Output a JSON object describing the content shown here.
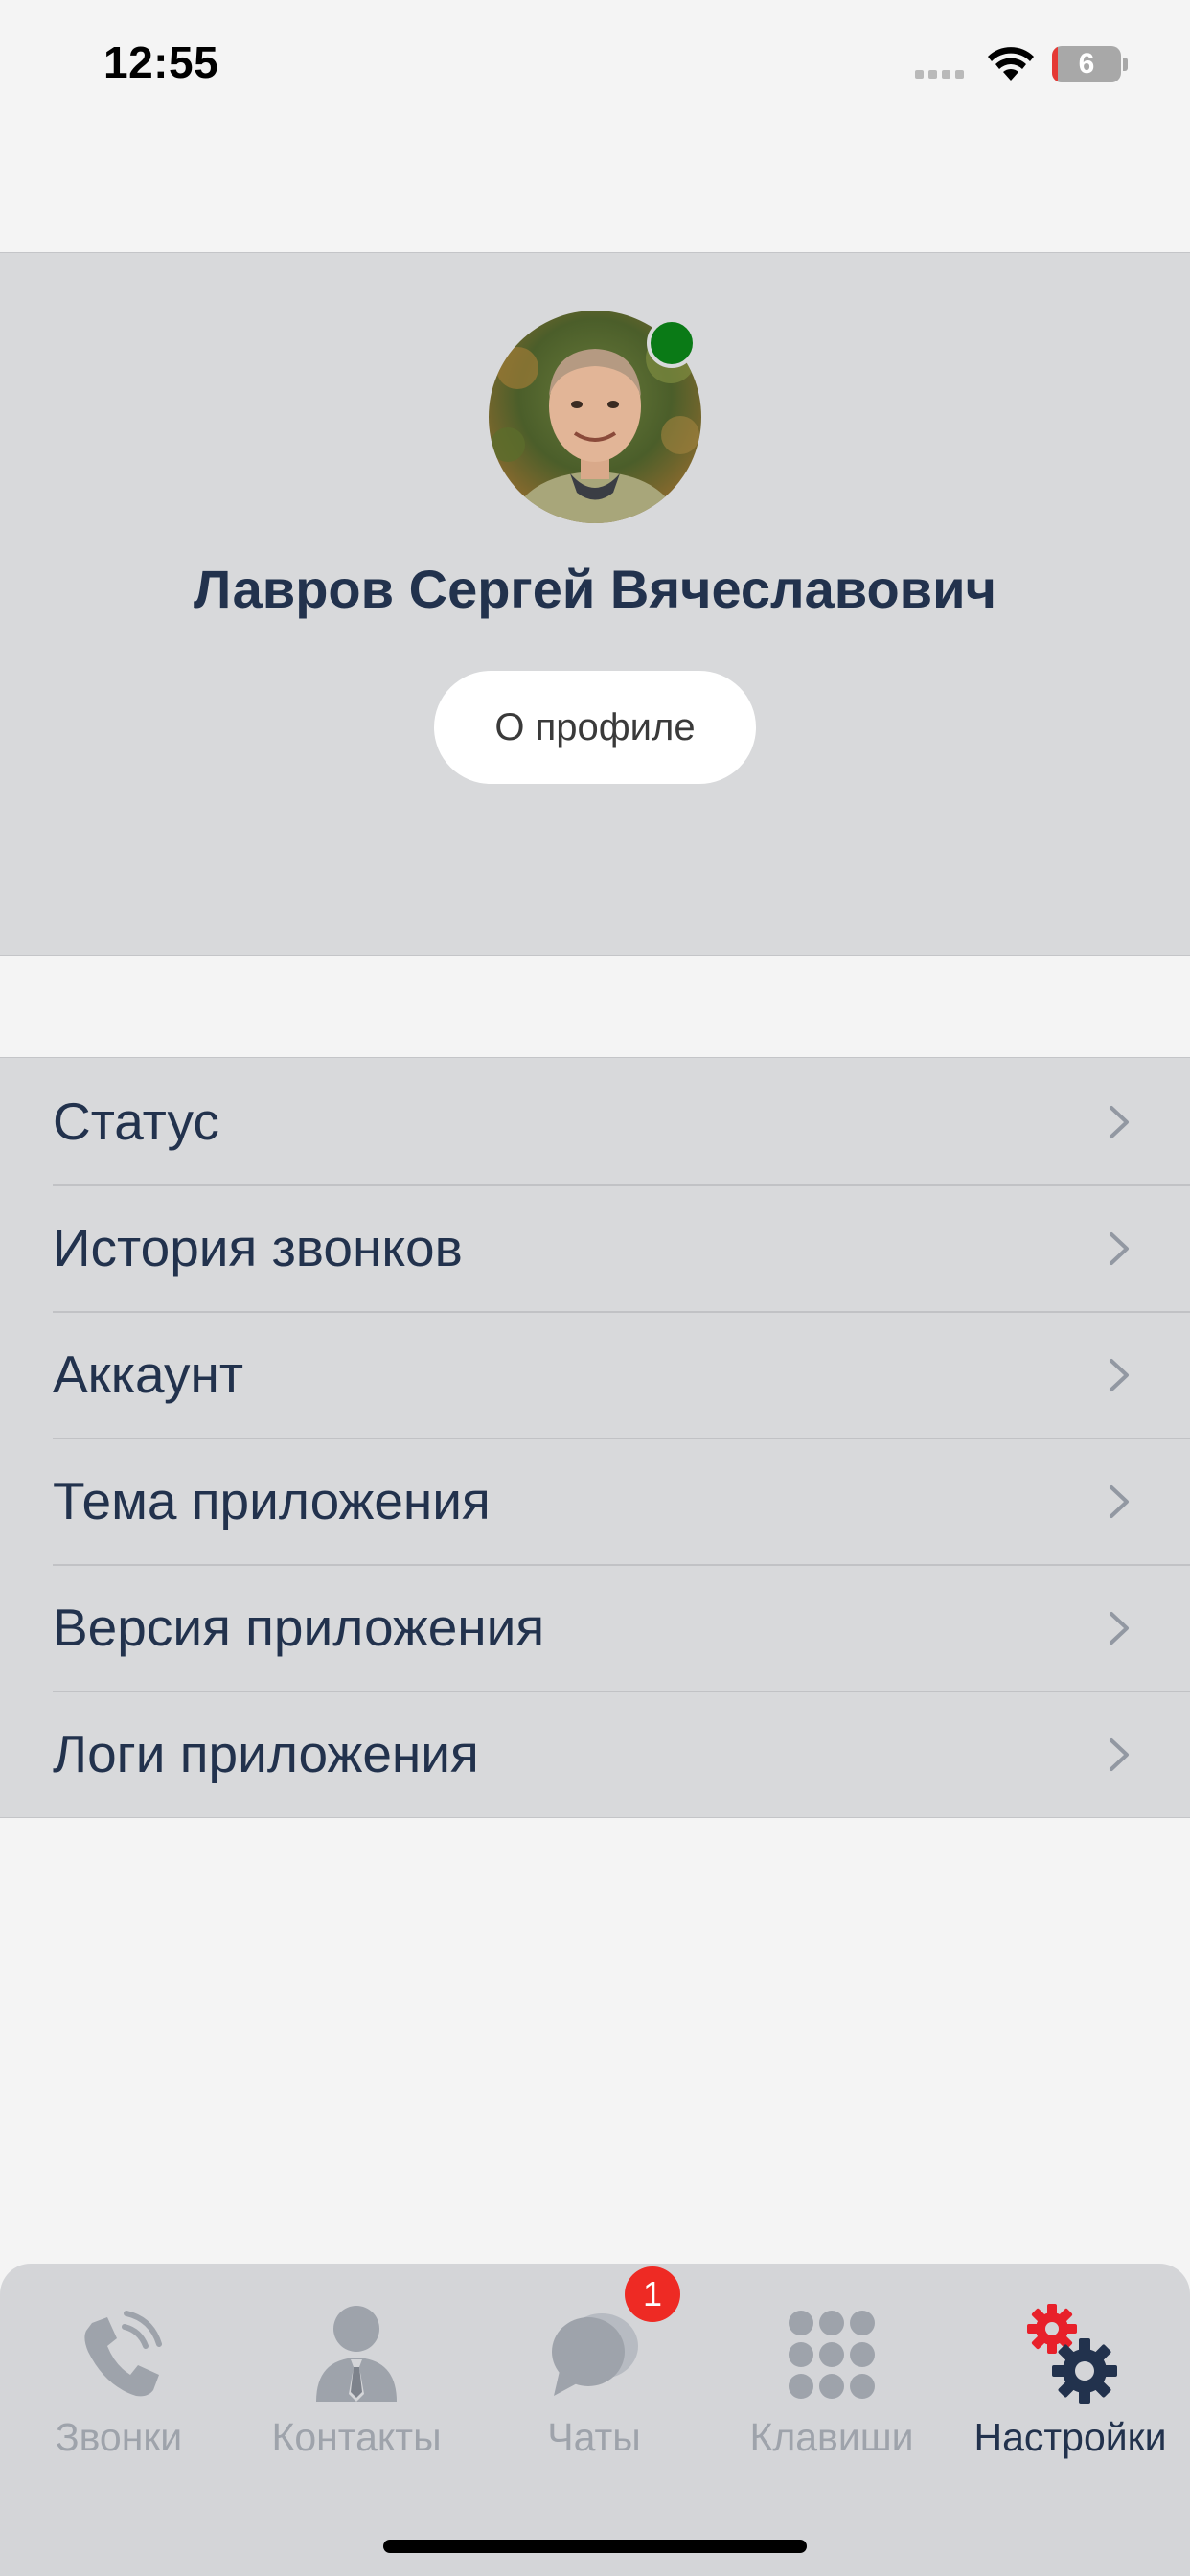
{
  "status_bar": {
    "time": "12:55",
    "battery_level": "6",
    "icons": [
      "signal-dots-icon",
      "wifi-icon",
      "battery-icon"
    ]
  },
  "profile": {
    "name": "Лавров Сергей Вячеславович",
    "about_button": "О профиле",
    "online_status_color": "#0a7a16"
  },
  "menu": {
    "items": [
      {
        "label": "Статус"
      },
      {
        "label": "История звонков"
      },
      {
        "label": "Аккаунт"
      },
      {
        "label": "Тема приложения"
      },
      {
        "label": "Версия приложения"
      },
      {
        "label": "Логи приложения"
      }
    ]
  },
  "tab_bar": {
    "tabs": [
      {
        "label": "Звонки",
        "icon": "phone-icon"
      },
      {
        "label": "Контакты",
        "icon": "contact-person-icon"
      },
      {
        "label": "Чаты",
        "icon": "chat-bubbles-icon",
        "badge": "1"
      },
      {
        "label": "Клавиши",
        "icon": "keypad-icon"
      },
      {
        "label": "Настройки",
        "icon": "settings-gears-icon",
        "active": true
      }
    ]
  },
  "colors": {
    "text_primary": "#22324d",
    "tab_inactive": "#9ea3ab",
    "badge": "#ee2a24",
    "settings_gear_accent": "#e8202a"
  }
}
